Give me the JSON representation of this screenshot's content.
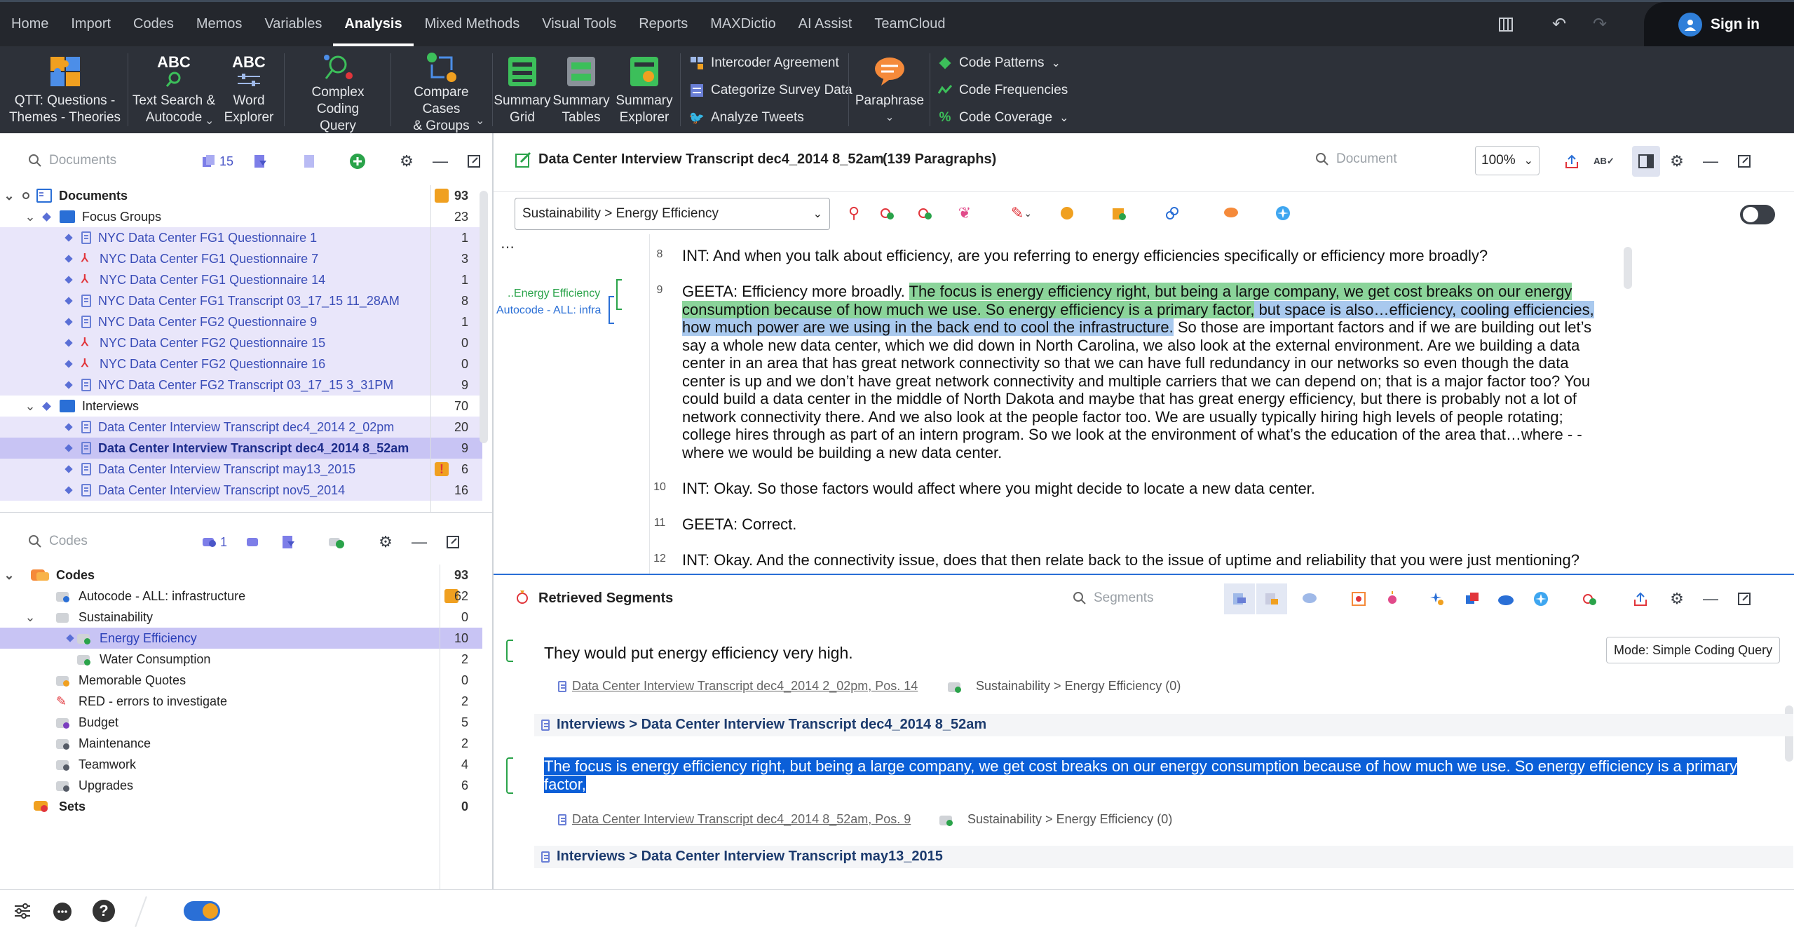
{
  "menu": {
    "tabs": [
      "Home",
      "Import",
      "Codes",
      "Memos",
      "Variables",
      "Analysis",
      "Mixed Methods",
      "Visual Tools",
      "Reports",
      "MAXDictio",
      "AI Assist",
      "TeamCloud"
    ],
    "active_tab": "Analysis",
    "sign_in": "Sign in"
  },
  "ribbon": {
    "qtt_line1": "QTT: Questions -",
    "qtt_line2": "Themes - Theories",
    "text_search_line1": "Text Search &",
    "text_search_line2": "Autocode",
    "word_explorer_line1": "Word",
    "word_explorer_line2": "Explorer",
    "complex_line1": "Complex Coding",
    "complex_line2": "Query",
    "compare_line1": "Compare Cases",
    "compare_line2": "& Groups",
    "summary_grid_line1": "Summary",
    "summary_grid_line2": "Grid",
    "summary_tables_line1": "Summary",
    "summary_tables_line2": "Tables",
    "summary_explorer_line1": "Summary",
    "summary_explorer_line2": "Explorer",
    "intercoder": "Intercoder Agreement",
    "categorize": "Categorize Survey Data",
    "tweets": "Analyze Tweets",
    "paraphrase": "Paraphrase",
    "code_patterns": "Code Patterns",
    "code_frequencies": "Code Frequencies",
    "code_coverage": "Code Coverage",
    "abc": "ABC"
  },
  "documents_pane": {
    "search_placeholder": "Documents",
    "active_count": "15",
    "root": {
      "label": "Documents",
      "count": "93"
    },
    "rows": [
      {
        "label": "Focus Groups",
        "count": "23",
        "kind": "folder"
      },
      {
        "label": "NYC Data Center FG1 Questionnaire 1",
        "count": "1",
        "kind": "doc"
      },
      {
        "label": "NYC Data Center FG1 Questionnaire 7",
        "count": "3",
        "kind": "pdf"
      },
      {
        "label": "NYC Data Center FG1 Questionnaire 14",
        "count": "1",
        "kind": "pdf"
      },
      {
        "label": "NYC Data Center FG1 Transcript 03_17_15 11_28AM",
        "count": "8",
        "kind": "doc"
      },
      {
        "label": "NYC Data Center FG2 Questionnaire 9",
        "count": "1",
        "kind": "doc"
      },
      {
        "label": "NYC Data Center FG2 Questionnaire 15",
        "count": "0",
        "kind": "pdf"
      },
      {
        "label": "NYC Data Center FG2 Questionnaire 16",
        "count": "0",
        "kind": "pdf"
      },
      {
        "label": "NYC Data Center FG2 Transcript 03_17_15 3_31PM",
        "count": "9",
        "kind": "doc"
      },
      {
        "label": "Interviews",
        "count": "70",
        "kind": "folder"
      },
      {
        "label": "Data Center Interview Transcript dec4_2014 2_02pm",
        "count": "20",
        "kind": "doc"
      },
      {
        "label": "Data Center Interview Transcript dec4_2014 8_52am",
        "count": "9",
        "kind": "doc"
      },
      {
        "label": "Data Center Interview Transcript may13_2015",
        "count": "6",
        "kind": "doc"
      },
      {
        "label": "Data Center Interview Transcript nov5_2014",
        "count": "16",
        "kind": "doc"
      }
    ]
  },
  "codes_pane": {
    "search_placeholder": "Codes",
    "active_count": "1",
    "root": {
      "label": "Codes",
      "count": "93"
    },
    "rows": [
      {
        "label": "Autocode - ALL: infrastructure",
        "count": "62",
        "color": "#2a6fd6"
      },
      {
        "label": "Sustainability",
        "count": "0",
        "color": ""
      },
      {
        "label": "Energy Efficiency",
        "count": "10",
        "color": "#2aa34a"
      },
      {
        "label": "Water Consumption",
        "count": "2",
        "color": "#2aa34a"
      },
      {
        "label": "Memorable Quotes",
        "count": "0",
        "color": "#f0a020"
      },
      {
        "label": "RED - errors to investigate",
        "count": "2",
        "color": "#e1353b"
      },
      {
        "label": "Budget",
        "count": "5",
        "color": "#7b3fbf"
      },
      {
        "label": "Maintenance",
        "count": "2",
        "color": "#555b66"
      },
      {
        "label": "Teamwork",
        "count": "4",
        "color": "#555b66"
      },
      {
        "label": "Upgrades",
        "count": "6",
        "color": "#555b66"
      }
    ],
    "sets": {
      "label": "Sets",
      "count": "0"
    }
  },
  "document_browser": {
    "title": "Data Center Interview Transcript dec4_2014 8_52am",
    "paragraphs_label": "(139 Paragraphs)",
    "search_placeholder": "Document",
    "zoom": "100%",
    "code_select": "Sustainability > Energy Efficiency",
    "margin_code1": "..Energy Efficiency",
    "margin_code2": "Autocode - ALL: infra",
    "p8_num": "8",
    "p8": "INT:  And when you talk about efficiency, are you referring to energy efficiencies specifically or efficiency more broadly?",
    "p9_num": "9",
    "p9_a": "GEETA:  Efficiency more broadly. ",
    "p9_green": "The focus is energy efficiency right, but being a large company, we get cost breaks on our energy consumption because of how much we use.  So energy efficiency is a primary factor,",
    "p9_blue": " but space is also…efficiency, cooling efficiencies, how much power are we using in the back end to cool the infrastructure.",
    "p9_rest": " So those are important factors and if we are building out let’s say a whole new data center, which we did down in North Carolina, we also look at the external environment.  Are we building a data center in an area that has great network connectivity so that we can have full redundancy in our networks so even though the data center is up and we don’t have great network connectivity and multiple carriers that we can depend on; that is a major factor too?  You could build a data center in the middle of North Dakota and maybe that has great energy efficiency, but there is probably not a lot of network connectivity there.  And we also look at the people factor too.  We are usually typically hiring high levels of people rotating; college hires through as part of an intern program.  So we look at the environment of what’s the education of the area that…where - - where we would be building a new data center.",
    "p10_num": "10",
    "p10": "INT:  Okay.  So those factors would affect where you might decide to locate a new data center.",
    "p11_num": "11",
    "p11": "GEETA:  Correct.",
    "p12_num": "12",
    "p12": "INT:  Okay. And the connectivity issue, does that then relate back to the issue of uptime and reliability that you were just mentioning?"
  },
  "retrieved": {
    "title": "Retrieved Segments",
    "search_placeholder": "Segments",
    "mode": "Mode: Simple Coding Query",
    "seg1_text": "They would put energy efficiency very high.",
    "seg1_source": "Data Center Interview Transcript dec4_2014 2_02pm, Pos. 14",
    "seg1_code": "Sustainability > Energy Efficiency (0)",
    "head2": "Interviews > Data Center Interview Transcript dec4_2014 8_52am",
    "seg2_text": "The focus is energy efficiency right, but being a large company, we get cost breaks on our energy consumption because of how much we use.  So energy efficiency is a primary factor,",
    "seg2_source": "Data Center Interview Transcript dec4_2014 8_52am, Pos. 9",
    "seg2_code": "Sustainability > Energy Efficiency (0)",
    "head3": "Interviews > Data Center Interview Transcript may13_2015"
  },
  "colors": {
    "menubar": "#24272d",
    "ribbon": "#2d3139",
    "selection": "#c8c4f4",
    "green_highlight": "#8bd49a",
    "blue_highlight": "#a9c9ee",
    "selected_text": "#0b5fd8"
  }
}
